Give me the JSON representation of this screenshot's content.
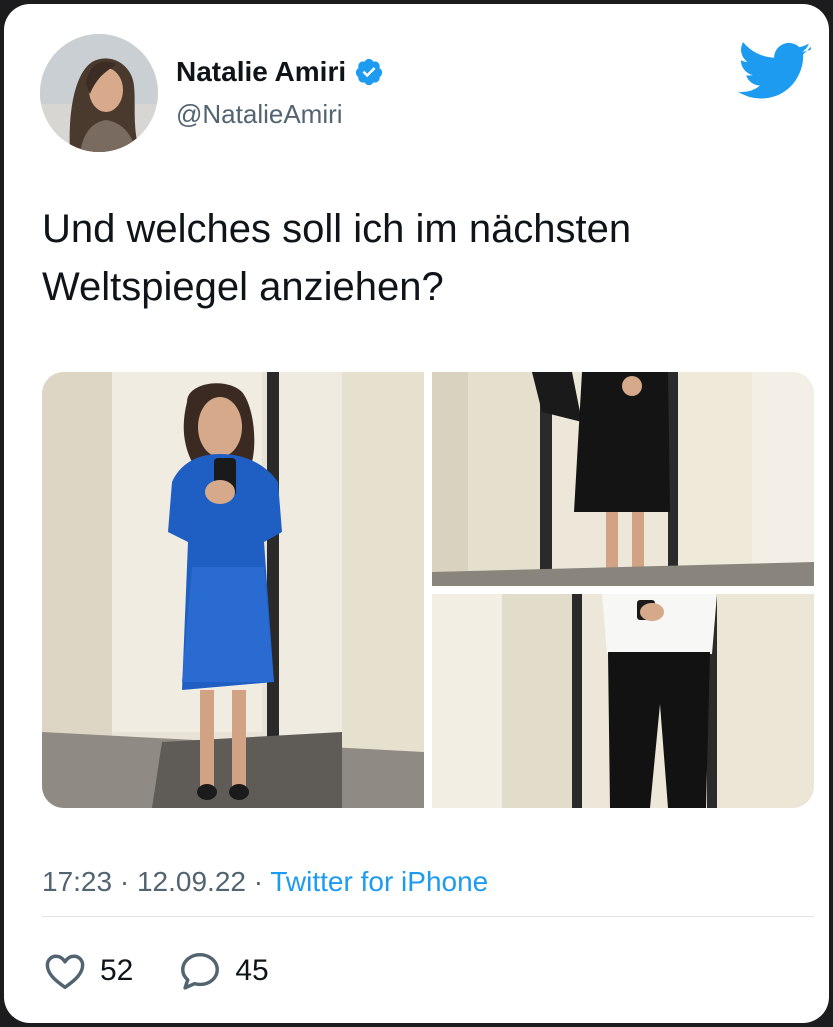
{
  "author": {
    "name": "Natalie Amiri",
    "handle": "@NatalieAmiri",
    "verified": true
  },
  "tweet": {
    "text_line1": "Und welches soll ich im nächsten",
    "text_line2": "Weltspiegel anziehen?",
    "time": "17:23",
    "separator": "·",
    "date": "12.09.22",
    "source": "Twitter for iPhone"
  },
  "media": [
    {
      "description": "blue dress mirror selfie"
    },
    {
      "description": "black dress mirror selfie"
    },
    {
      "description": "white top black trousers mirror selfie"
    }
  ],
  "stats": {
    "likes": "52",
    "replies": "45"
  },
  "colors": {
    "twitter_blue": "#1d9bf0",
    "text": "#0f1419",
    "secondary_text": "#536471"
  },
  "icons": [
    "verified-badge-icon",
    "twitter-bird-icon",
    "heart-icon",
    "reply-bubble-icon"
  ]
}
